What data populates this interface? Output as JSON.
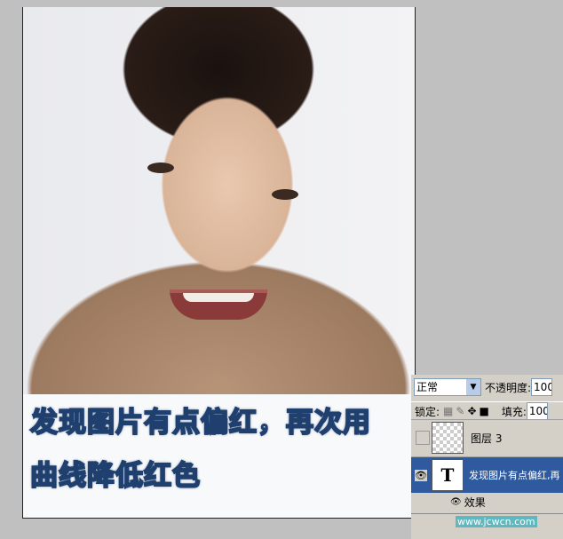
{
  "caption": {
    "line1": "发现图片有点偏红，再次用",
    "line2": "曲线降低红色"
  },
  "layers_panel": {
    "blend_mode": "正常",
    "opacity_label": "不透明度:",
    "opacity_value": "100",
    "lock_label": "锁定:",
    "fill_label": "填充:",
    "fill_value": "100",
    "layers": [
      {
        "name": "图层 3"
      },
      {
        "name": "发现图片有点偏红,再",
        "thumb": "T"
      }
    ],
    "effects_label": "效果"
  },
  "watermark": "www.jcwcn.com"
}
